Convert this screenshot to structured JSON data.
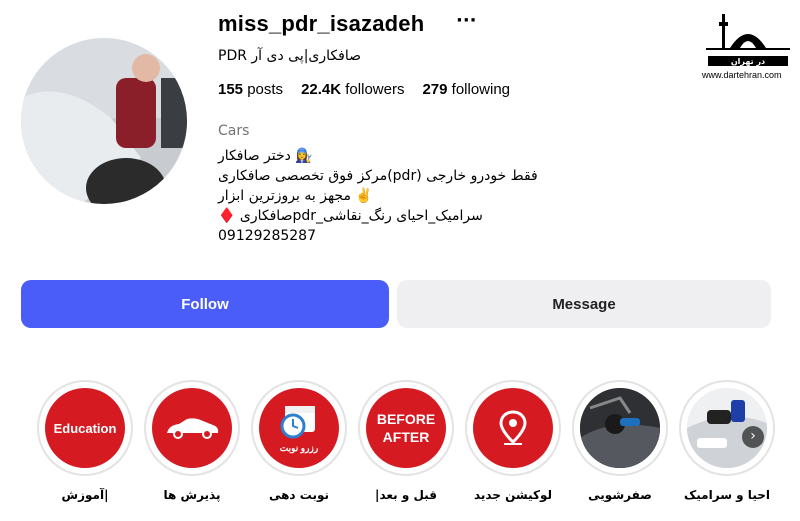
{
  "profile": {
    "username": "miss_pdr_isazadeh",
    "more_label": "···",
    "full_name": "PDR صافکاری|پی دی آر",
    "stats": {
      "posts_count": "155",
      "posts_label": "posts",
      "followers_count": "22.4K",
      "followers_label": "followers",
      "following_count": "279",
      "following_label": "following"
    },
    "category": "Cars",
    "bio_lines": [
      "دختر صافکار 👩‍🔧",
      "مرکز فوق تخصصی صافکاری(pdr) فقط خودرو خارجی",
      "مجهز به بروزترین ابزار ✌️",
      "♦️ صافکاریpdr_سرامیک_احیای رنگ_نقاشی",
      "09129285287"
    ]
  },
  "watermark": {
    "url": "www.dartehran.com",
    "brand": "در تهران"
  },
  "actions": {
    "follow_label": "Follow",
    "message_label": "Message"
  },
  "highlights": [
    {
      "label": "آموزش|",
      "cover": "Education"
    },
    {
      "label": "پذیرش ها",
      "cover": "car-icon"
    },
    {
      "label": "نوبت دهی",
      "cover": "رزرو نوبت"
    },
    {
      "label": "|قبل و بعد",
      "cover": "BEFORE AFTER"
    },
    {
      "label": "لوکیشن جدید",
      "cover": "location-pin-icon"
    },
    {
      "label": "صفرشویی",
      "cover": "photo"
    },
    {
      "label": "احیا و سرامیک",
      "cover": "photo"
    }
  ],
  "colors": {
    "follow_bg": "#4a5df9",
    "highlight_red": "#d61a22",
    "message_bg": "#efeff2"
  }
}
